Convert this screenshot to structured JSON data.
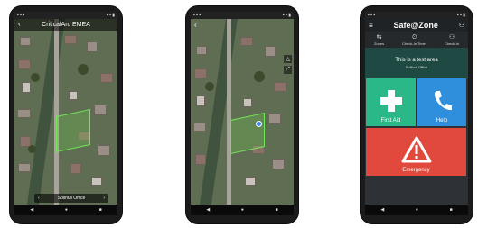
{
  "phone1": {
    "title": "CriticalArc EMEA",
    "location_label": "Solihull Office",
    "nav": [
      "◀",
      "●",
      "■"
    ]
  },
  "phone2": {
    "nav": [
      "◀",
      "●",
      "■"
    ]
  },
  "phone3": {
    "logo": "Safe@Zone",
    "nav_items": [
      "Zones",
      "Check-In Timer",
      "Check-In"
    ],
    "banner_title": "This is a test area",
    "banner_subtitle": "Solihull Office",
    "tiles": {
      "first_aid": "First Aid",
      "help": "Help",
      "emergency": "Emergency"
    },
    "nav": [
      "◀",
      "●",
      "■"
    ]
  },
  "colors": {
    "first_aid": "#2ab889",
    "help": "#2f8fdc",
    "emergency": "#e0493c",
    "zone_outline": "#74e35a"
  }
}
